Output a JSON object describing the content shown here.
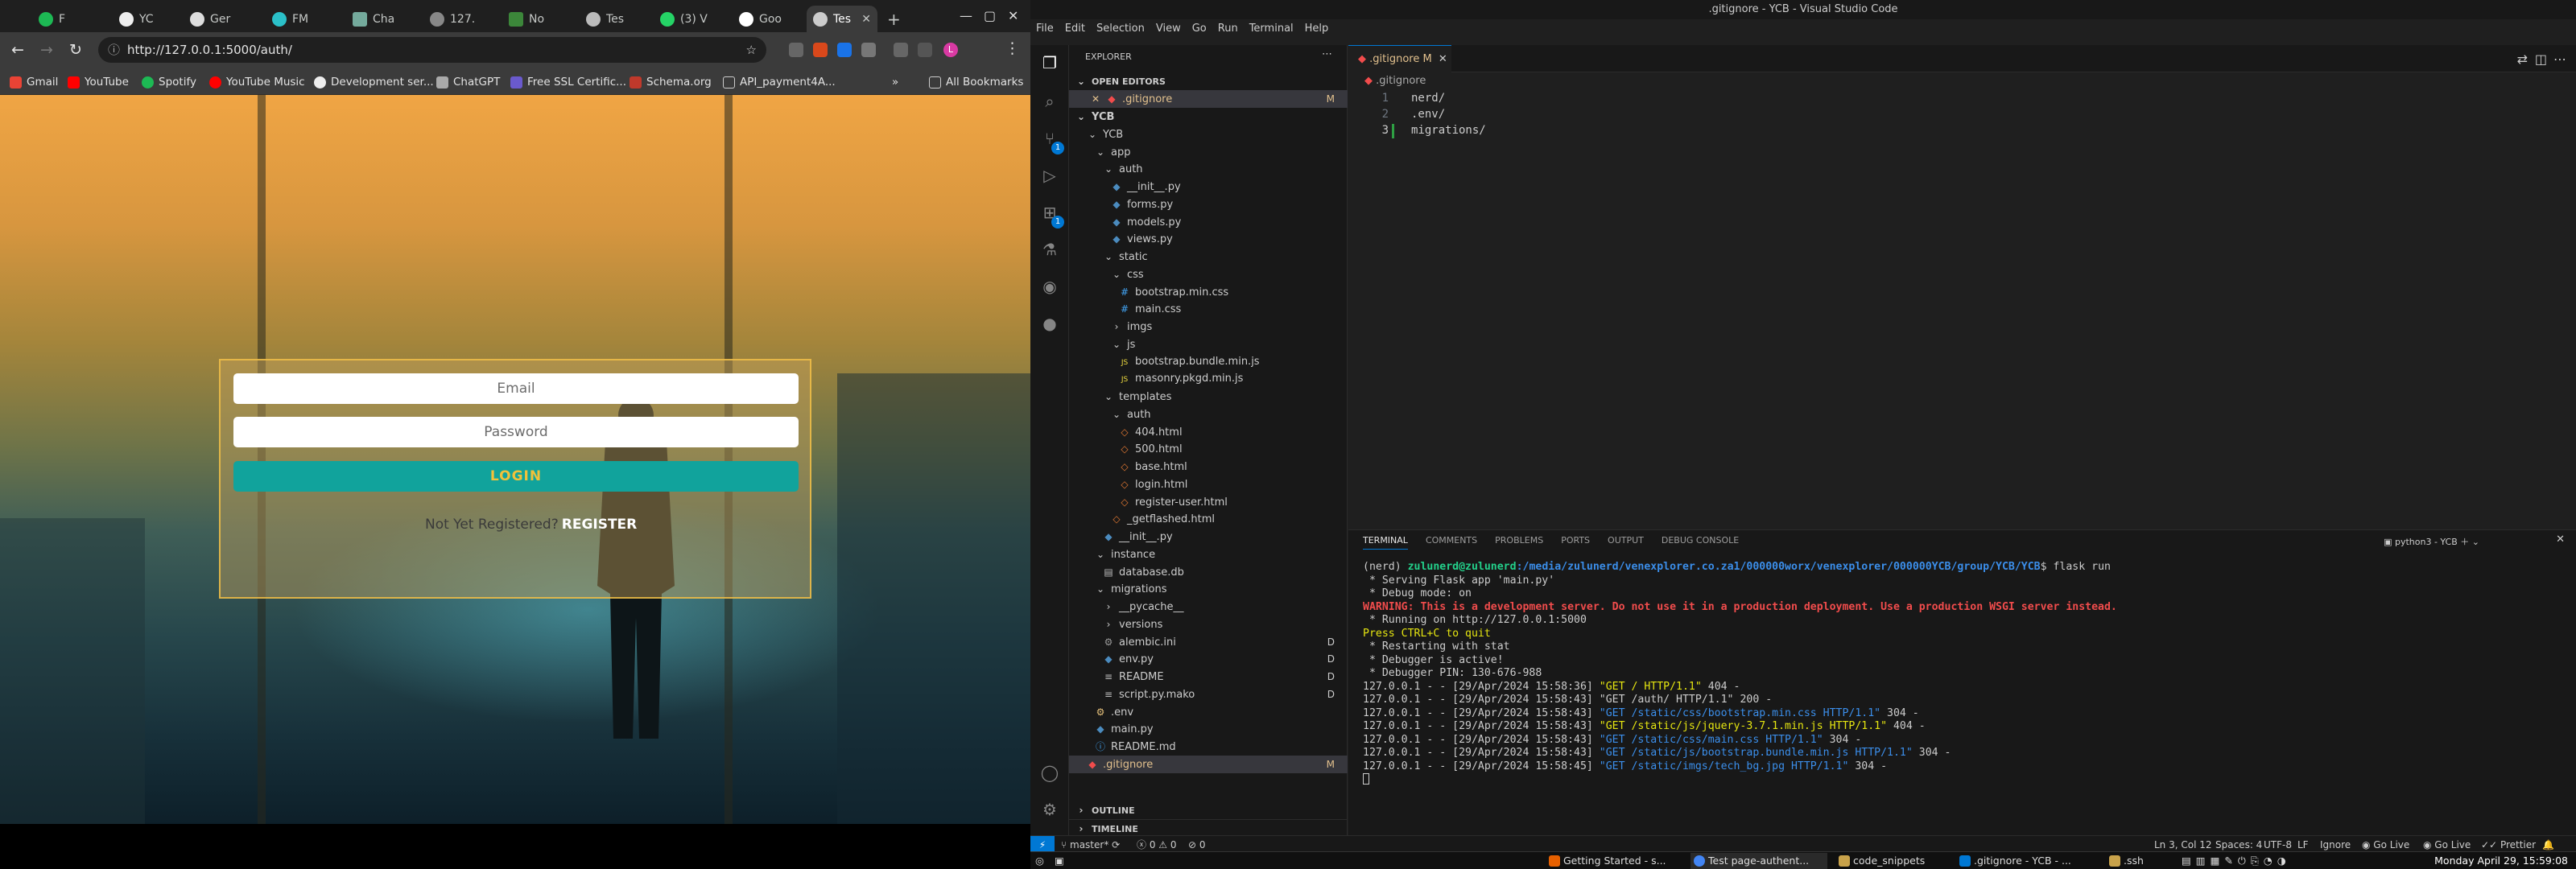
{
  "browser": {
    "tabs": [
      "F",
      "YC",
      "Ger",
      "FM",
      "Cha",
      "127.",
      "No",
      "Tes",
      "(3) V",
      "Goo",
      "Tes"
    ],
    "active_tab_index": 10,
    "url": "http://127.0.0.1:5000/auth/",
    "bookmarks": [
      "Gmail",
      "YouTube",
      "Spotify",
      "YouTube Music",
      "Development ser...",
      "ChatGPT",
      "Free SSL Certific...",
      "Schema.org",
      "API_payment4A..."
    ],
    "all_bookmarks": "All Bookmarks",
    "more_bookmarks": "»",
    "profile_initial": "L"
  },
  "login_page": {
    "email_placeholder": "Email",
    "password_placeholder": "Password",
    "login_button": "LOGIN",
    "register_prompt": "Not Yet Registered?",
    "register_link": "REGISTER"
  },
  "vscode": {
    "title": ".gitignore - YCB - Visual Studio Code",
    "menu": [
      "File",
      "Edit",
      "Selection",
      "View",
      "Go",
      "Run",
      "Terminal",
      "Help"
    ],
    "explorer_title": "EXPLORER",
    "open_editors_label": "OPEN EDITORS",
    "open_editor_file": ".gitignore",
    "open_editor_status": "M",
    "scm_badge": "1",
    "ext_badge": "1",
    "tree": [
      {
        "label": "YCB",
        "depth": 0,
        "kind": "root"
      },
      {
        "label": "YCB",
        "depth": 1,
        "kind": "folder"
      },
      {
        "label": "app",
        "depth": 2,
        "kind": "folder"
      },
      {
        "label": "auth",
        "depth": 3,
        "kind": "folder"
      },
      {
        "label": "__init__.py",
        "depth": 4,
        "kind": "py"
      },
      {
        "label": "forms.py",
        "depth": 4,
        "kind": "py"
      },
      {
        "label": "models.py",
        "depth": 4,
        "kind": "py"
      },
      {
        "label": "views.py",
        "depth": 4,
        "kind": "py"
      },
      {
        "label": "static",
        "depth": 3,
        "kind": "folder"
      },
      {
        "label": "css",
        "depth": 4,
        "kind": "folder"
      },
      {
        "label": "bootstrap.min.css",
        "depth": 5,
        "kind": "css"
      },
      {
        "label": "main.css",
        "depth": 5,
        "kind": "css"
      },
      {
        "label": "imgs",
        "depth": 4,
        "kind": "folder-closed"
      },
      {
        "label": "js",
        "depth": 4,
        "kind": "folder"
      },
      {
        "label": "bootstrap.bundle.min.js",
        "depth": 5,
        "kind": "js"
      },
      {
        "label": "masonry.pkgd.min.js",
        "depth": 5,
        "kind": "js"
      },
      {
        "label": "templates",
        "depth": 3,
        "kind": "folder"
      },
      {
        "label": "auth",
        "depth": 4,
        "kind": "folder"
      },
      {
        "label": "404.html",
        "depth": 5,
        "kind": "html"
      },
      {
        "label": "500.html",
        "depth": 5,
        "kind": "html"
      },
      {
        "label": "base.html",
        "depth": 5,
        "kind": "html"
      },
      {
        "label": "login.html",
        "depth": 5,
        "kind": "html"
      },
      {
        "label": "register-user.html",
        "depth": 5,
        "kind": "html"
      },
      {
        "label": "_getflashed.html",
        "depth": 4,
        "kind": "html"
      },
      {
        "label": "__init__.py",
        "depth": 3,
        "kind": "py"
      },
      {
        "label": "instance",
        "depth": 2,
        "kind": "folder"
      },
      {
        "label": "database.db",
        "depth": 3,
        "kind": "db"
      },
      {
        "label": "migrations",
        "depth": 2,
        "kind": "folder"
      },
      {
        "label": "__pycache__",
        "depth": 3,
        "kind": "folder-closed"
      },
      {
        "label": "versions",
        "depth": 3,
        "kind": "folder-closed"
      },
      {
        "label": "alembic.ini",
        "depth": 3,
        "kind": "ini",
        "deco": "D"
      },
      {
        "label": "env.py",
        "depth": 3,
        "kind": "py",
        "deco": "D"
      },
      {
        "label": "README",
        "depth": 3,
        "kind": "txt",
        "deco": "D"
      },
      {
        "label": "script.py.mako",
        "depth": 3,
        "kind": "txt",
        "deco": "D"
      },
      {
        "label": ".env",
        "depth": 2,
        "kind": "env"
      },
      {
        "label": "main.py",
        "depth": 2,
        "kind": "py"
      },
      {
        "label": "README.md",
        "depth": 2,
        "kind": "md"
      },
      {
        "label": ".gitignore",
        "depth": 1,
        "kind": "git",
        "deco": "M",
        "selected": true
      }
    ],
    "outline_label": "OUTLINE",
    "timeline_label": "TIMELINE",
    "editor_tab": ".gitignore",
    "editor_tab_status": "M",
    "breadcrumb": ".gitignore",
    "code_lines": [
      "nerd/",
      ".env/",
      "migrations/"
    ],
    "panel_tabs": [
      "TERMINAL",
      "COMMENTS",
      "PROBLEMS",
      "PORTS",
      "OUTPUT",
      "DEBUG CONSOLE"
    ],
    "terminal_name": "python3 - YCB",
    "terminal": {
      "prompt_env": "(nerd) ",
      "prompt_user": "zulunerd@zulunerd",
      "prompt_path": ":/media/zulunerd/venexplorer.co.za1/000000worx/venexplorer/000000YCB/group/YCB/YCB",
      "prompt_cmd": "$ flask run",
      "line1": " * Serving Flask app 'main.py'",
      "line2": " * Debug mode: on",
      "warning": "WARNING: This is a development server. Do not use it in a production deployment. Use a production WSGI server instead.",
      "running": " * Running on http://127.0.0.1:5000",
      "quit": "Press CTRL+C to quit",
      "restart": " * Restarting with stat",
      "debugger_active": " * Debugger is active!",
      "debugger_pin": " * Debugger PIN: 130-676-988",
      "log": [
        {
          "prefix": "127.0.0.1 - - [29/Apr/2024 15:58:36] ",
          "req": "\"GET / HTTP/1.1\"",
          "code": " 404 -",
          "color": "#e5e510"
        },
        {
          "prefix": "127.0.0.1 - - [29/Apr/2024 15:58:43] ",
          "req": "\"GET /auth/ HTTP/1.1\"",
          "code": " 200 -",
          "color": "#cccccc"
        },
        {
          "prefix": "127.0.0.1 - - [29/Apr/2024 15:58:43] ",
          "req": "\"GET /static/css/bootstrap.min.css HTTP/1.1\"",
          "code": " 304 -",
          "color": "#3b8eea"
        },
        {
          "prefix": "127.0.0.1 - - [29/Apr/2024 15:58:43] ",
          "req": "\"GET /static/js/jquery-3.7.1.min.js HTTP/1.1\"",
          "code": " 404 -",
          "color": "#e5e510"
        },
        {
          "prefix": "127.0.0.1 - - [29/Apr/2024 15:58:43] ",
          "req": "\"GET /static/css/main.css HTTP/1.1\"",
          "code": " 304 -",
          "color": "#3b8eea"
        },
        {
          "prefix": "127.0.0.1 - - [29/Apr/2024 15:58:43] ",
          "req": "\"GET /static/js/bootstrap.bundle.min.js HTTP/1.1\"",
          "code": " 304 -",
          "color": "#3b8eea"
        },
        {
          "prefix": "127.0.0.1 - - [29/Apr/2024 15:58:45] ",
          "req": "\"GET /static/imgs/tech_bg.jpg HTTP/1.1\"",
          "code": " 304 -",
          "color": "#3b8eea"
        }
      ]
    },
    "status": {
      "branch": "master*",
      "errors": "0",
      "warnings": "0",
      "ports": "0",
      "position": "Ln 3, Col 12",
      "spaces": "Spaces: 4",
      "encoding": "UTF-8",
      "eol": "LF",
      "language": "Ignore",
      "golive1": "Go Live",
      "golive2": "Go Live",
      "prettier": "Prettier"
    }
  },
  "taskbar": {
    "windows": [
      "Getting Started - s...",
      "Test page-authent...",
      "code_snippets",
      ".gitignore - YCB - ...",
      ".ssh"
    ],
    "clock": "Monday April 29, 15:59:08"
  },
  "colors": {
    "accent": "#0078d4",
    "login_button": "#11a39c",
    "login_text": "#f1c13a",
    "modified": "#e2c08d"
  }
}
